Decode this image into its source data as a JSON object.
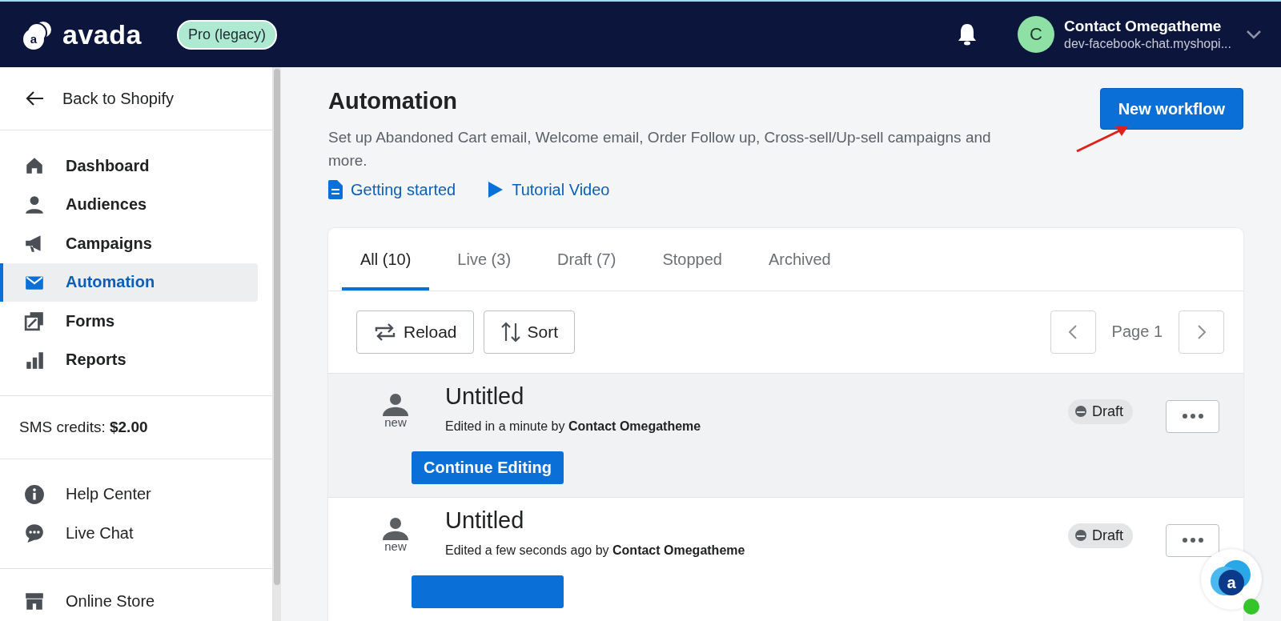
{
  "header": {
    "logo_mark": "a",
    "logo_text": "avada",
    "plan_badge": "Pro (legacy)",
    "account": {
      "initial": "C",
      "name": "Contact Omegatheme",
      "store": "dev-facebook-chat.myshopi..."
    }
  },
  "sidebar": {
    "back": "Back to Shopify",
    "items": [
      {
        "label": "Dashboard",
        "selected": false
      },
      {
        "label": "Audiences",
        "selected": false
      },
      {
        "label": "Campaigns",
        "selected": false
      },
      {
        "label": "Automation",
        "selected": true
      },
      {
        "label": "Forms",
        "selected": false
      },
      {
        "label": "Reports",
        "selected": false
      }
    ],
    "sms_credits": "SMS credits: **$2.00**",
    "support": [
      "Help Center",
      "Live Chat"
    ],
    "store": "Online Store"
  },
  "page": {
    "title": "Automation",
    "description": "Set up Abandoned Cart email, Welcome email, Order Follow up, Cross-sell/Up-sell campaigns and more.",
    "links": [
      "Getting started",
      "Tutorial Video"
    ],
    "primary_button": "New workflow"
  },
  "tabs": [
    {
      "label": "All (10)",
      "selected": true
    },
    {
      "label": "Live (3)",
      "selected": false
    },
    {
      "label": "Draft (7)",
      "selected": false
    },
    {
      "label": "Stopped",
      "selected": false
    },
    {
      "label": "Archived",
      "selected": false
    }
  ],
  "toolbar": {
    "buttons": [
      "Reload",
      "Sort"
    ],
    "page": "Page 1"
  },
  "workflows": [
    {
      "badge": "new",
      "title": "Untitled",
      "meta": "Edited in a minute by **Contact Omegatheme**",
      "status": "Draft",
      "action": "Continue Editing",
      "highlighted": true
    },
    {
      "badge": "new",
      "title": "Untitled",
      "meta": "Edited a few seconds ago by **Contact Omegatheme**",
      "status": "Draft",
      "highlighted": false
    }
  ],
  "chat_launcher": {
    "mark": "a"
  }
}
